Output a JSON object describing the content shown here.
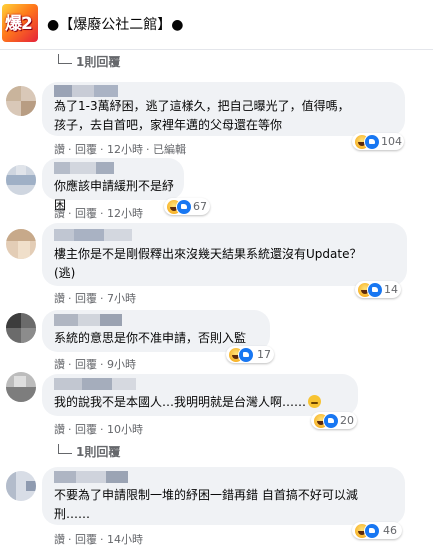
{
  "header": {
    "group_title": "●【爆廢公社二館】●"
  },
  "colors": {
    "accent": "#1877f2",
    "bubble": "#f0f2f5",
    "meta_text": "#65676b"
  },
  "replies_link_1": "1則回覆",
  "replies_link_2": "1則回覆",
  "comments": [
    {
      "lines": [
        "為了1-3萬紓困，逃了這樣久，把自己曝光了，值得嗎，",
        "孩子，去自首吧，家裡年邁的父母還在等你"
      ],
      "like": "讚",
      "reply": "回覆",
      "time": "12小時",
      "edited": "已編輯",
      "reactions": [
        "haha-icon",
        "like-icon"
      ],
      "count": "104"
    },
    {
      "lines": [
        "你應該申請緩刑不是紓困"
      ],
      "like": "讚",
      "reply": "回覆",
      "time": "12小時",
      "reactions": [
        "haha-icon",
        "like-icon"
      ],
      "count": "67"
    },
    {
      "lines": [
        "樓主你是不是剛假釋出來沒幾天結果系統還沒有Update？",
        "(逃)"
      ],
      "like": "讚",
      "reply": "回覆",
      "time": "7小時",
      "reactions": [
        "haha-icon",
        "like-icon"
      ],
      "count": "14"
    },
    {
      "lines": [
        "系統的意思是你不准申請，否則入監"
      ],
      "like": "讚",
      "reply": "回覆",
      "time": "9小時",
      "reactions": [
        "haha-icon",
        "like-icon"
      ],
      "count": "17"
    },
    {
      "lines": [
        "我的說我不是本國人…我明明就是台灣人啊……"
      ],
      "emoji": "sweat-smile-emoji",
      "like": "讚",
      "reply": "回覆",
      "time": "10小時",
      "reactions": [
        "haha-icon",
        "like-icon"
      ],
      "count": "20"
    },
    {
      "lines": [
        "不要為了申請限制一堆的紓困一錯再錯 自首搞不好可以減",
        "刑……"
      ],
      "like": "讚",
      "reply": "回覆",
      "time": "14小時",
      "reactions": [
        "haha-icon",
        "like-icon"
      ],
      "count": "46"
    }
  ]
}
